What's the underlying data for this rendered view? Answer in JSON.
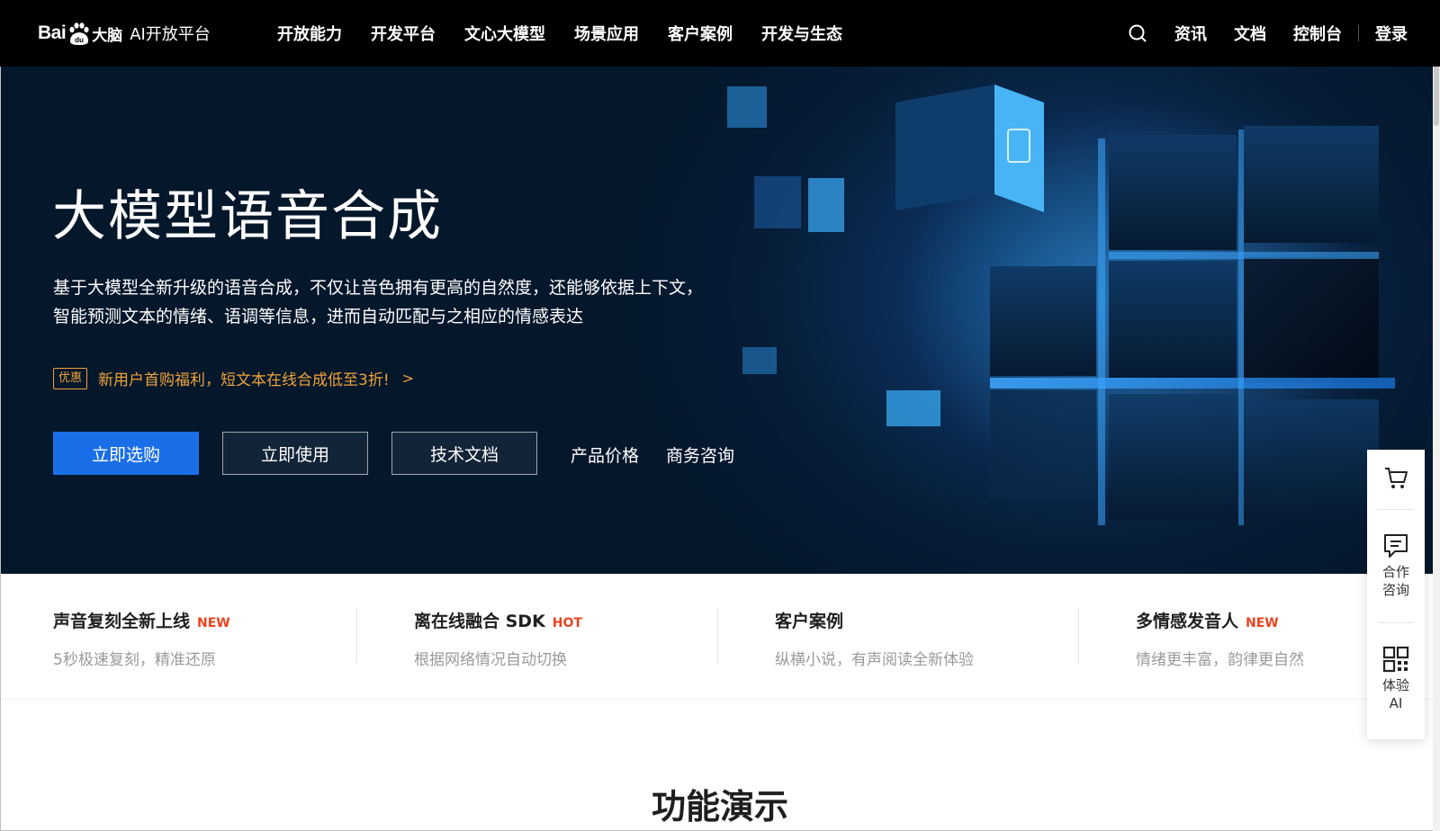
{
  "nav": {
    "logo": {
      "brand": "Bai",
      "paw_text": "du",
      "brand_cn": "大脑",
      "platform": "AI开放平台"
    },
    "menu": [
      {
        "label": "开放能力"
      },
      {
        "label": "开发平台"
      },
      {
        "label": "文心大模型"
      },
      {
        "label": "场景应用"
      },
      {
        "label": "客户案例"
      },
      {
        "label": "开发与生态"
      }
    ],
    "right": {
      "news": "资讯",
      "docs": "文档",
      "console": "控制台",
      "login": "登录"
    }
  },
  "hero": {
    "title": "大模型语音合成",
    "desc_line1": "基于大模型全新升级的语音合成，不仅让音色拥有更高的自然度，还能够依据上下文，",
    "desc_line2": "智能预测文本的情绪、语调等信息，进而自动匹配与之相应的情感表达",
    "promo_badge": "优惠",
    "promo_text": "新用户首购福利，短文本在线合成低至3折!",
    "promo_arrow": ">",
    "buttons": {
      "buy": "立即选购",
      "use": "立即使用",
      "docs": "技术文档"
    },
    "links": {
      "price": "产品价格",
      "consult": "商务咨询"
    }
  },
  "features": [
    {
      "title": "声音复刻全新上线",
      "tag": "NEW",
      "desc": "5秒极速复刻，精准还原"
    },
    {
      "title": "离在线融合 SDK",
      "tag": "HOT",
      "desc": "根据网络情况自动切换"
    },
    {
      "title": "客户案例",
      "tag": "",
      "desc": "纵横小说，有声阅读全新体验"
    },
    {
      "title": "多情感发音人",
      "tag": "NEW",
      "desc": "情绪更丰富，韵律更自然"
    }
  ],
  "section": {
    "title": "功能演示"
  },
  "float_bar": {
    "cart": {
      "icon": "cart-icon"
    },
    "consult": {
      "icon": "chat-icon",
      "line1": "合作",
      "line2": "咨询"
    },
    "try": {
      "icon": "qrcode-icon",
      "line1": "体验",
      "line2": "AI"
    }
  },
  "colors": {
    "primary": "#1a6ee8",
    "promo": "#f0a23a",
    "tag": "#e94420",
    "hero_bg": "#04172b"
  }
}
